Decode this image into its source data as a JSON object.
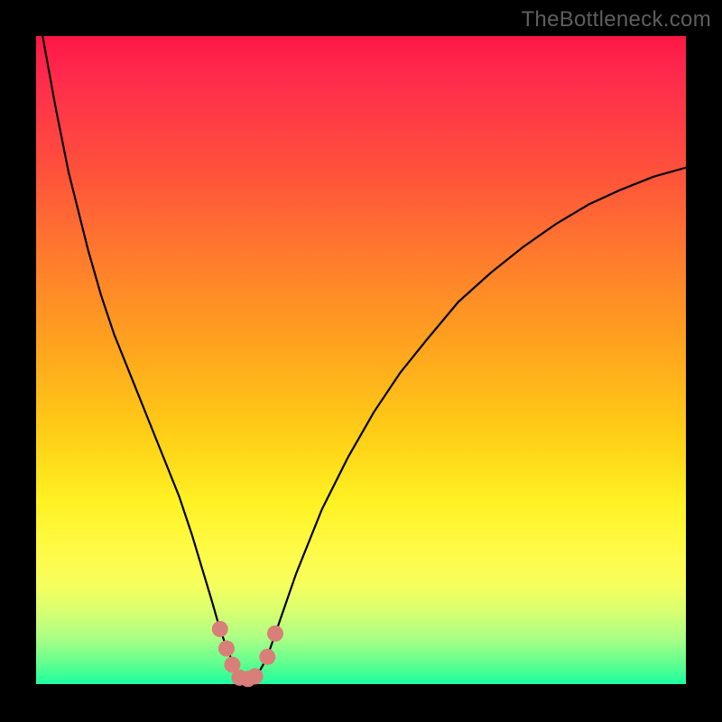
{
  "watermark": "TheBottleneck.com",
  "colors": {
    "curve": "#000000",
    "marker_fill": "#d97f7a",
    "marker_stroke": "#b35b56"
  },
  "chart_data": {
    "type": "line",
    "title": "",
    "xlabel": "",
    "ylabel": "",
    "xlim": [
      0,
      100
    ],
    "ylim": [
      0,
      100
    ],
    "grid": false,
    "background": "vertical rainbow gradient (red→green), background color encodes y-value (worse top / better bottom)",
    "series": [
      {
        "name": "bottleneck-curve",
        "x": [
          1,
          3,
          5,
          8,
          10,
          12,
          14,
          16,
          18,
          20,
          22,
          24,
          25.5,
          27,
          28,
          29,
          30,
          30.8,
          31.5,
          32.3,
          33,
          34,
          35.5,
          37,
          40,
          44,
          48,
          52,
          56,
          60,
          65,
          70,
          75,
          80,
          85,
          90,
          95,
          100
        ],
        "y": [
          100,
          89,
          79,
          67,
          60,
          54,
          49,
          44,
          39,
          34,
          29,
          23,
          18,
          13,
          9.5,
          6.5,
          4,
          2,
          1,
          0.6,
          0.6,
          1.3,
          4,
          8.3,
          17,
          27,
          35,
          42,
          48,
          53,
          59,
          63.5,
          67.5,
          71,
          74,
          76.3,
          78.3,
          79.7
        ]
      }
    ],
    "markers": [
      {
        "x": 28.3,
        "y": 8.5
      },
      {
        "x": 29.3,
        "y": 5.5
      },
      {
        "x": 30.2,
        "y": 3.0
      },
      {
        "x": 31.3,
        "y": 1.0
      },
      {
        "x": 32.6,
        "y": 0.8
      },
      {
        "x": 33.7,
        "y": 1.2
      },
      {
        "x": 35.6,
        "y": 4.2
      },
      {
        "x": 36.8,
        "y": 7.8
      }
    ],
    "marker_radius_px": 9
  }
}
